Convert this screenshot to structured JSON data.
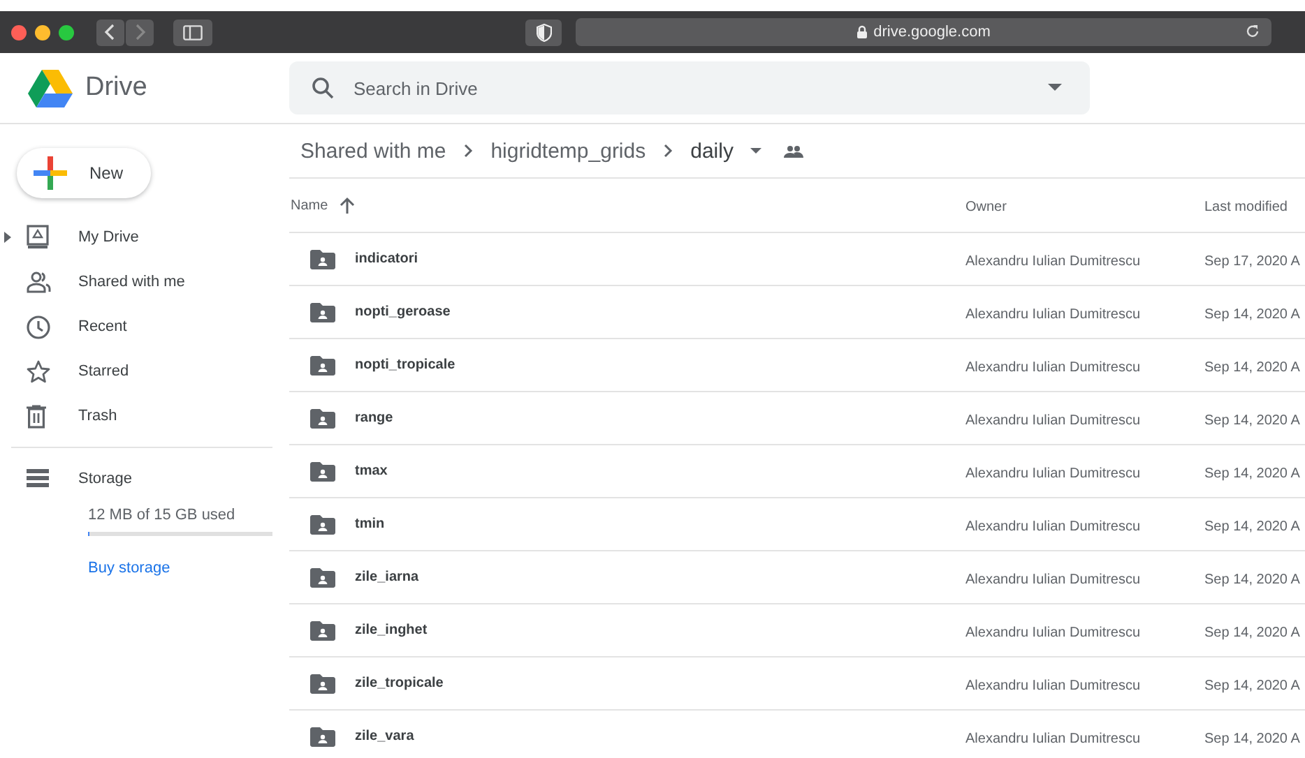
{
  "browser": {
    "address": "drive.google.com"
  },
  "app": {
    "name": "Drive"
  },
  "search": {
    "placeholder": "Search in Drive"
  },
  "new_button": {
    "label": "New"
  },
  "sidebar": {
    "items": [
      {
        "label": "My Drive",
        "kind": "drive",
        "expandable": true
      },
      {
        "label": "Shared with me",
        "kind": "shared",
        "expandable": false
      },
      {
        "label": "Recent",
        "kind": "recent",
        "expandable": false
      },
      {
        "label": "Starred",
        "kind": "starred",
        "expandable": false
      },
      {
        "label": "Trash",
        "kind": "trash",
        "expandable": false
      }
    ]
  },
  "storage": {
    "label": "Storage",
    "usage": "12 MB of 15 GB used",
    "level": 0.008,
    "link": "Buy storage"
  },
  "breadcrumbs": [
    "Shared with me",
    "higridtemp_grids",
    "daily"
  ],
  "table": {
    "columns": [
      "Name",
      "Owner",
      "Last modified"
    ],
    "rows": [
      {
        "name": "indicatori",
        "owner": "Alexandru Iulian Dumitrescu",
        "modified": "Sep 17, 2020 A"
      },
      {
        "name": "nopti_geroase",
        "owner": "Alexandru Iulian Dumitrescu",
        "modified": "Sep 14, 2020 A"
      },
      {
        "name": "nopti_tropicale",
        "owner": "Alexandru Iulian Dumitrescu",
        "modified": "Sep 14, 2020 A"
      },
      {
        "name": "range",
        "owner": "Alexandru Iulian Dumitrescu",
        "modified": "Sep 14, 2020 A"
      },
      {
        "name": "tmax",
        "owner": "Alexandru Iulian Dumitrescu",
        "modified": "Sep 14, 2020 A"
      },
      {
        "name": "tmin",
        "owner": "Alexandru Iulian Dumitrescu",
        "modified": "Sep 14, 2020 A"
      },
      {
        "name": "zile_iarna",
        "owner": "Alexandru Iulian Dumitrescu",
        "modified": "Sep 14, 2020 A"
      },
      {
        "name": "zile_inghet",
        "owner": "Alexandru Iulian Dumitrescu",
        "modified": "Sep 14, 2020 A"
      },
      {
        "name": "zile_tropicale",
        "owner": "Alexandru Iulian Dumitrescu",
        "modified": "Sep 14, 2020 A"
      },
      {
        "name": "zile_vara",
        "owner": "Alexandru Iulian Dumitrescu",
        "modified": "Sep 14, 2020 A"
      }
    ]
  }
}
